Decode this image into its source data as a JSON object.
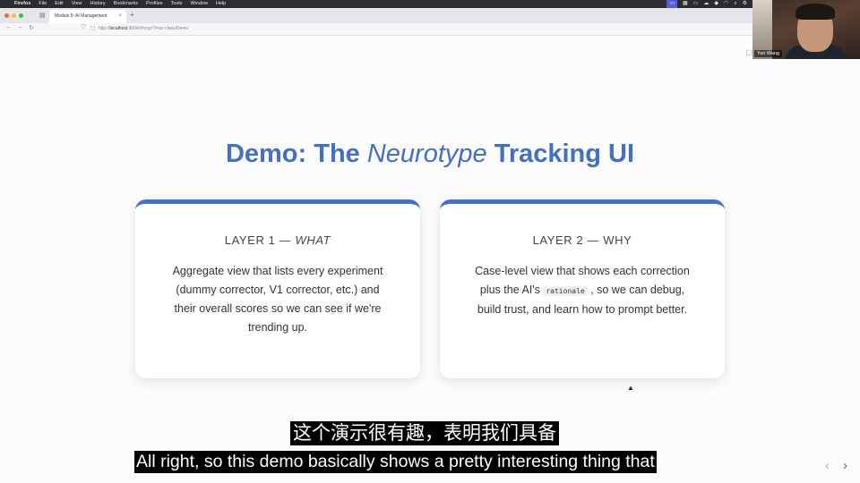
{
  "menubar": {
    "app_name": "Firefox",
    "items": [
      "File",
      "Edit",
      "View",
      "History",
      "Bookmarks",
      "Profiles",
      "Tools",
      "Window",
      "Help"
    ]
  },
  "browser": {
    "tab_title": "Module 5: AI Management",
    "url_prefix": "http://",
    "url_host": "localhost",
    "url_rest": ":8004/#/orgs?i=an-class/Demo"
  },
  "webcam": {
    "name": "Yan Wang"
  },
  "slide": {
    "title_before": "Demo: The ",
    "title_emph": "Neurotype",
    "title_after": " Tracking UI",
    "cards": [
      {
        "heading_prefix": "LAYER 1 — ",
        "heading_emph": "WHAT",
        "body": "Aggregate view that lists every experiment (dummy corrector, V1 corrector, etc.) and their overall scores so we can see if we're trending up."
      },
      {
        "heading_prefix": "LAYER 2 — WHY",
        "body_before": "Case-level view that shows each correction plus the AI's ",
        "body_code": "rationale",
        "body_after": " , so we can debug, build trust, and learn how to prompt better."
      }
    ]
  },
  "subtitles": {
    "zh": "这个演示很有趣，表明我们具备",
    "en": "All right, so this demo basically shows a pretty interesting thing that"
  },
  "colors": {
    "accent": "#4370c4",
    "card_border": "#4a6fc0",
    "menubar": "#2b2b30",
    "traffic_red": "#ff5f57",
    "traffic_yellow": "#febc2e",
    "traffic_green": "#28c840"
  }
}
